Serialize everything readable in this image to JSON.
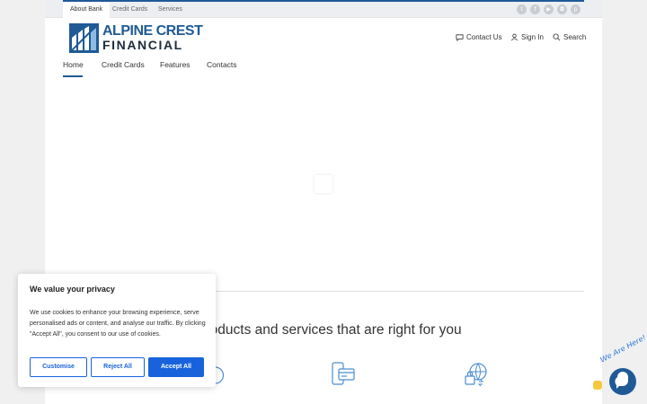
{
  "topbar": {
    "tabs": [
      "About Bank",
      "Credit Cards",
      "Services"
    ],
    "social_icons": [
      "twitter-icon",
      "facebook-icon",
      "youtube-icon",
      "instagram-icon",
      "pinterest-icon"
    ]
  },
  "brand": {
    "line1": "ALPINE CREST",
    "line2": "FINANCIAL",
    "color": "#1f5a96"
  },
  "utility": {
    "contact": "Contact Us",
    "signin": "Sign In",
    "search": "Search"
  },
  "nav": {
    "items": [
      "Home",
      "Credit Cards",
      "Features",
      "Contacts"
    ],
    "active": "Home"
  },
  "main": {
    "headline": "ng products and services that are right for you"
  },
  "cookie": {
    "title": "We value your privacy",
    "body": "We use cookies to enhance your browsing experience, serve personalised ads or content, and analyse our traffic. By clicking \"Accept All\", you consent to our use of cookies.",
    "customise": "Customise",
    "reject": "Reject All",
    "accept": "Accept All",
    "accent": "#1863dc"
  },
  "chat": {
    "label": "We Are Here!"
  }
}
